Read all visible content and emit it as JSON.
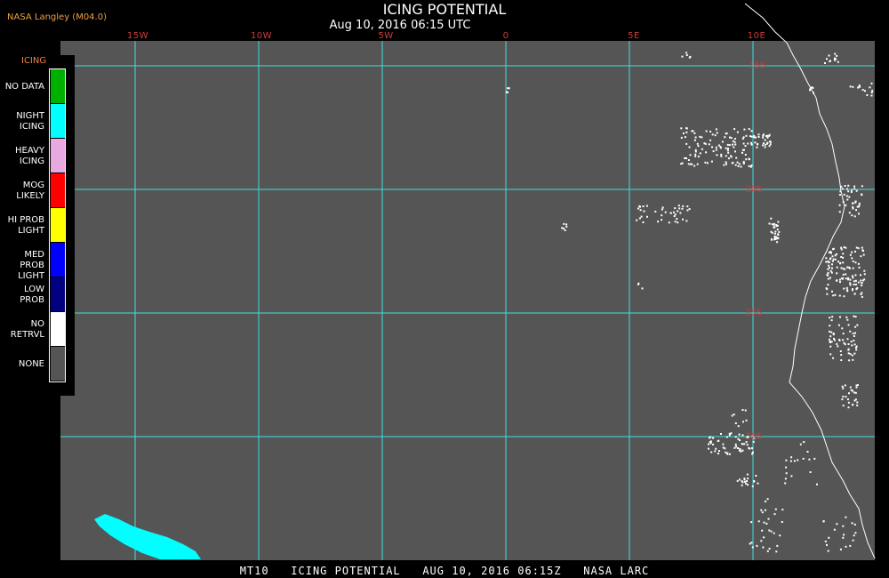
{
  "header": {
    "credit": "NASA Langley (M04.0)",
    "title": "ICING POTENTIAL",
    "subtitle": "Aug 10, 2016 06:15 UTC"
  },
  "map": {
    "longitude_labels": [
      "15W",
      "10W",
      "5W",
      "0",
      "5E",
      "10E"
    ],
    "latitude_labels": [
      "15S",
      "20S",
      "25S",
      "30S"
    ],
    "background_color": "#555555",
    "gridline_color": "#40e0e0",
    "coastline_color": "#ffffff"
  },
  "legend": {
    "title": "ICING",
    "items": [
      {
        "label_lines": [
          "NO DATA"
        ],
        "color": "#00b000"
      },
      {
        "label_lines": [
          "NIGHT",
          "ICING"
        ],
        "color": "#00ffff"
      },
      {
        "label_lines": [
          "HEAVY",
          "ICING"
        ],
        "color": "#e8a8e0"
      },
      {
        "label_lines": [
          "MOG",
          "LIKELY"
        ],
        "color": "#ff0000"
      },
      {
        "label_lines": [
          "HI PROB",
          "LIGHT"
        ],
        "color": "#ffff00"
      },
      {
        "label_lines": [
          "MED PROB",
          "LIGHT"
        ],
        "color": "#0000ff"
      },
      {
        "label_lines": [
          "LOW",
          "PROB"
        ],
        "color": "#000080"
      },
      {
        "label_lines": [
          "NO",
          "RETRVL"
        ],
        "color": "#ffffff"
      },
      {
        "label_lines": [
          "NONE"
        ],
        "color": "#555555"
      }
    ]
  },
  "footer": {
    "text": "MT10   ICING POTENTIAL   AUG 10, 2016 06:15Z   NASA LARC"
  }
}
